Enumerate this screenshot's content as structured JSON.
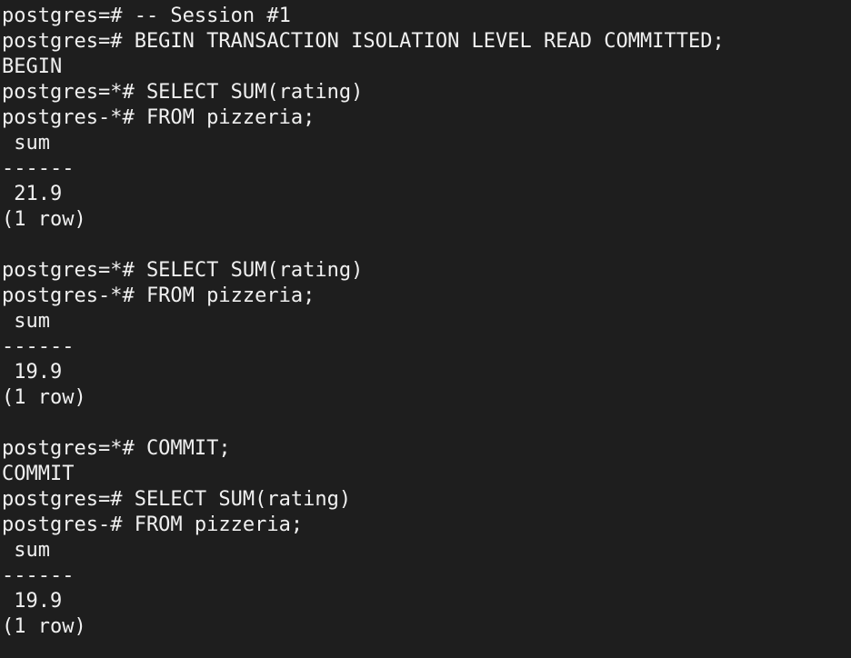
{
  "terminal": {
    "lines": [
      "postgres=# -- Session #1",
      "postgres=# BEGIN TRANSACTION ISOLATION LEVEL READ COMMITTED;",
      "BEGIN",
      "postgres=*# SELECT SUM(rating)",
      "postgres-*# FROM pizzeria;",
      " sum",
      "------",
      " 21.9",
      "(1 row)",
      "",
      "postgres=*# SELECT SUM(rating)",
      "postgres-*# FROM pizzeria;",
      " sum",
      "------",
      " 19.9",
      "(1 row)",
      "",
      "postgres=*# COMMIT;",
      "COMMIT",
      "postgres=# SELECT SUM(rating)",
      "postgres-# FROM pizzeria;",
      " sum",
      "------",
      " 19.9",
      "(1 row)"
    ]
  }
}
